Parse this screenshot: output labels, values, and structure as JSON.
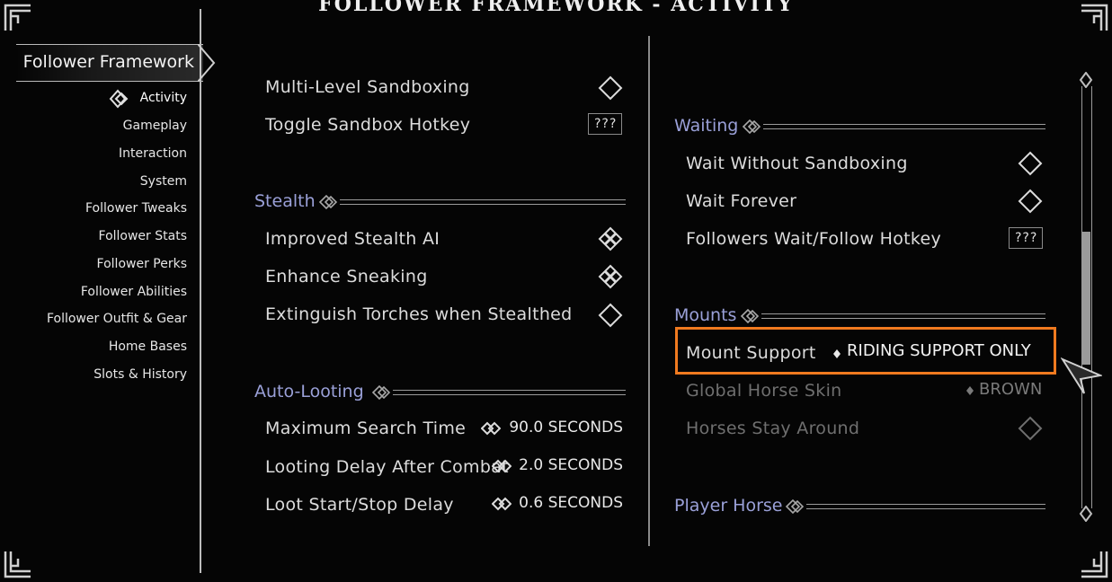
{
  "title": "FOLLOWER FRAMEWORK - ACTIVITY",
  "nav": {
    "main": "Follower Framework",
    "items": [
      "Activity",
      "Gameplay",
      "Interaction",
      "System",
      "Follower Tweaks",
      "Follower Stats",
      "Follower Perks",
      "Follower Abilities",
      "Follower Outfit & Gear",
      "Home Bases",
      "Slots & History"
    ]
  },
  "left": {
    "rows_top": [
      {
        "label": "Multi-Level Sandboxing",
        "control": "checkbox-off"
      },
      {
        "label": "Toggle Sandbox Hotkey",
        "hotkey": "???"
      }
    ],
    "stealth": {
      "header": "Stealth",
      "rows": [
        {
          "label": "Improved Stealth AI",
          "control": "checkbox-on"
        },
        {
          "label": "Enhance Sneaking",
          "control": "checkbox-on"
        },
        {
          "label": "Extinguish Torches when Stealthed",
          "control": "checkbox-off"
        }
      ]
    },
    "looting": {
      "header": "Auto-Looting",
      "rows": [
        {
          "label": "Maximum Search Time",
          "value": "90.0 SECONDS"
        },
        {
          "label": "Looting Delay After Combat",
          "value": "2.0 SECONDS"
        },
        {
          "label": "Loot Start/Stop Delay",
          "value": "0.6 SECONDS"
        }
      ]
    }
  },
  "right": {
    "waiting": {
      "header": "Waiting",
      "rows": [
        {
          "label": "Wait Without Sandboxing",
          "control": "checkbox-off"
        },
        {
          "label": "Wait Forever",
          "control": "checkbox-off"
        },
        {
          "label": "Followers Wait/Follow Hotkey",
          "hotkey": "???"
        }
      ]
    },
    "mounts": {
      "header": "Mounts",
      "rows": [
        {
          "label": "Mount Support",
          "value": "RIDING SUPPORT ONLY"
        },
        {
          "label": "Global Horse Skin",
          "value": "BROWN"
        },
        {
          "label": "Horses Stay Around",
          "control": "checkbox-off"
        }
      ]
    },
    "player_horse": {
      "header": "Player Horse"
    }
  },
  "colors": {
    "highlight": "#f07a1f",
    "header": "#9aa0d8"
  }
}
